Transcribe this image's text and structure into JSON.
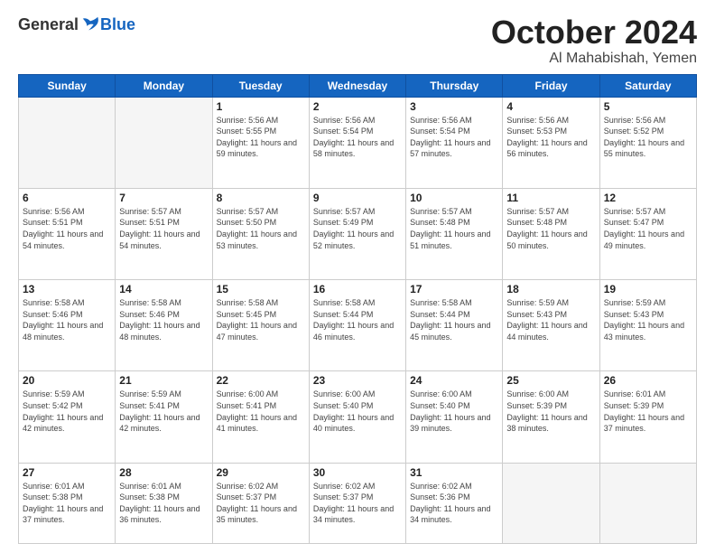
{
  "logo": {
    "general": "General",
    "blue": "Blue"
  },
  "title": "October 2024",
  "location": "Al Mahabishah, Yemen",
  "headers": [
    "Sunday",
    "Monday",
    "Tuesday",
    "Wednesday",
    "Thursday",
    "Friday",
    "Saturday"
  ],
  "weeks": [
    [
      {
        "day": "",
        "info": ""
      },
      {
        "day": "",
        "info": ""
      },
      {
        "day": "1",
        "info": "Sunrise: 5:56 AM\nSunset: 5:55 PM\nDaylight: 11 hours and 59 minutes."
      },
      {
        "day": "2",
        "info": "Sunrise: 5:56 AM\nSunset: 5:54 PM\nDaylight: 11 hours and 58 minutes."
      },
      {
        "day": "3",
        "info": "Sunrise: 5:56 AM\nSunset: 5:54 PM\nDaylight: 11 hours and 57 minutes."
      },
      {
        "day": "4",
        "info": "Sunrise: 5:56 AM\nSunset: 5:53 PM\nDaylight: 11 hours and 56 minutes."
      },
      {
        "day": "5",
        "info": "Sunrise: 5:56 AM\nSunset: 5:52 PM\nDaylight: 11 hours and 55 minutes."
      }
    ],
    [
      {
        "day": "6",
        "info": "Sunrise: 5:56 AM\nSunset: 5:51 PM\nDaylight: 11 hours and 54 minutes."
      },
      {
        "day": "7",
        "info": "Sunrise: 5:57 AM\nSunset: 5:51 PM\nDaylight: 11 hours and 54 minutes."
      },
      {
        "day": "8",
        "info": "Sunrise: 5:57 AM\nSunset: 5:50 PM\nDaylight: 11 hours and 53 minutes."
      },
      {
        "day": "9",
        "info": "Sunrise: 5:57 AM\nSunset: 5:49 PM\nDaylight: 11 hours and 52 minutes."
      },
      {
        "day": "10",
        "info": "Sunrise: 5:57 AM\nSunset: 5:48 PM\nDaylight: 11 hours and 51 minutes."
      },
      {
        "day": "11",
        "info": "Sunrise: 5:57 AM\nSunset: 5:48 PM\nDaylight: 11 hours and 50 minutes."
      },
      {
        "day": "12",
        "info": "Sunrise: 5:57 AM\nSunset: 5:47 PM\nDaylight: 11 hours and 49 minutes."
      }
    ],
    [
      {
        "day": "13",
        "info": "Sunrise: 5:58 AM\nSunset: 5:46 PM\nDaylight: 11 hours and 48 minutes."
      },
      {
        "day": "14",
        "info": "Sunrise: 5:58 AM\nSunset: 5:46 PM\nDaylight: 11 hours and 48 minutes."
      },
      {
        "day": "15",
        "info": "Sunrise: 5:58 AM\nSunset: 5:45 PM\nDaylight: 11 hours and 47 minutes."
      },
      {
        "day": "16",
        "info": "Sunrise: 5:58 AM\nSunset: 5:44 PM\nDaylight: 11 hours and 46 minutes."
      },
      {
        "day": "17",
        "info": "Sunrise: 5:58 AM\nSunset: 5:44 PM\nDaylight: 11 hours and 45 minutes."
      },
      {
        "day": "18",
        "info": "Sunrise: 5:59 AM\nSunset: 5:43 PM\nDaylight: 11 hours and 44 minutes."
      },
      {
        "day": "19",
        "info": "Sunrise: 5:59 AM\nSunset: 5:43 PM\nDaylight: 11 hours and 43 minutes."
      }
    ],
    [
      {
        "day": "20",
        "info": "Sunrise: 5:59 AM\nSunset: 5:42 PM\nDaylight: 11 hours and 42 minutes."
      },
      {
        "day": "21",
        "info": "Sunrise: 5:59 AM\nSunset: 5:41 PM\nDaylight: 11 hours and 42 minutes."
      },
      {
        "day": "22",
        "info": "Sunrise: 6:00 AM\nSunset: 5:41 PM\nDaylight: 11 hours and 41 minutes."
      },
      {
        "day": "23",
        "info": "Sunrise: 6:00 AM\nSunset: 5:40 PM\nDaylight: 11 hours and 40 minutes."
      },
      {
        "day": "24",
        "info": "Sunrise: 6:00 AM\nSunset: 5:40 PM\nDaylight: 11 hours and 39 minutes."
      },
      {
        "day": "25",
        "info": "Sunrise: 6:00 AM\nSunset: 5:39 PM\nDaylight: 11 hours and 38 minutes."
      },
      {
        "day": "26",
        "info": "Sunrise: 6:01 AM\nSunset: 5:39 PM\nDaylight: 11 hours and 37 minutes."
      }
    ],
    [
      {
        "day": "27",
        "info": "Sunrise: 6:01 AM\nSunset: 5:38 PM\nDaylight: 11 hours and 37 minutes."
      },
      {
        "day": "28",
        "info": "Sunrise: 6:01 AM\nSunset: 5:38 PM\nDaylight: 11 hours and 36 minutes."
      },
      {
        "day": "29",
        "info": "Sunrise: 6:02 AM\nSunset: 5:37 PM\nDaylight: 11 hours and 35 minutes."
      },
      {
        "day": "30",
        "info": "Sunrise: 6:02 AM\nSunset: 5:37 PM\nDaylight: 11 hours and 34 minutes."
      },
      {
        "day": "31",
        "info": "Sunrise: 6:02 AM\nSunset: 5:36 PM\nDaylight: 11 hours and 34 minutes."
      },
      {
        "day": "",
        "info": ""
      },
      {
        "day": "",
        "info": ""
      }
    ]
  ]
}
